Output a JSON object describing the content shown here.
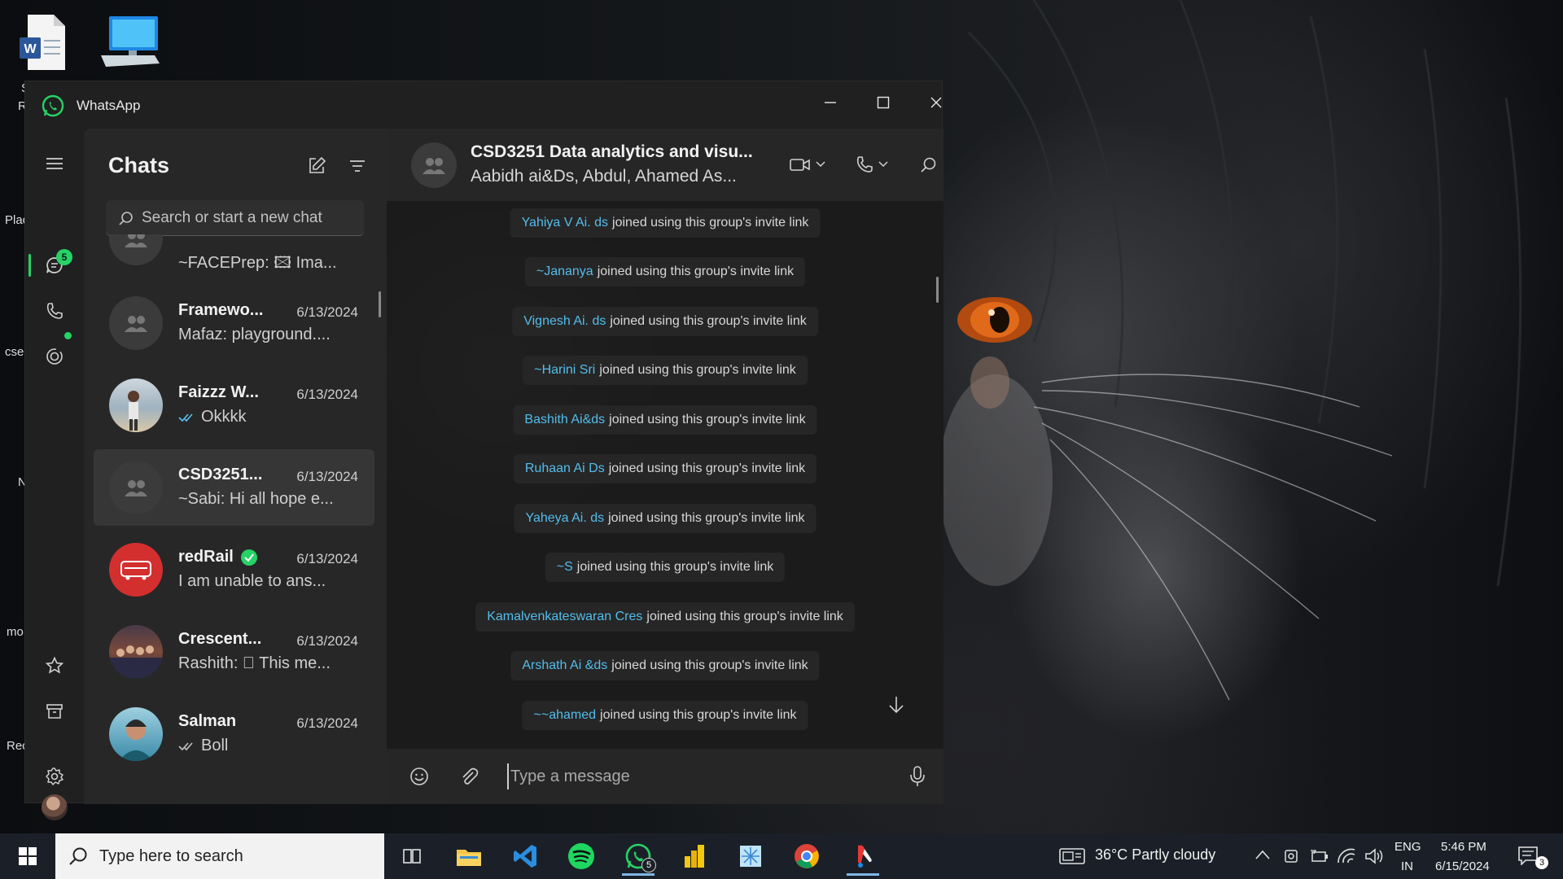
{
  "desktop": {
    "labels": [
      "S",
      "R",
      "Plac",
      "cse",
      "N",
      "mo",
      "Rec"
    ]
  },
  "window": {
    "title": "WhatsApp",
    "controls": {
      "minimize": "minimize-icon",
      "maximize": "maximize-icon",
      "close": "close-icon"
    }
  },
  "rail": {
    "chats_badge": "5",
    "items": [
      "menu-icon",
      "chats-icon",
      "calls-icon",
      "status-icon",
      "starred-icon",
      "archive-icon",
      "settings-icon",
      "profile-avatar"
    ]
  },
  "chatlist": {
    "title": "Chats",
    "search_placeholder": "Search or start a new chat",
    "items": [
      {
        "name": "",
        "date": "",
        "message": "~FACEPrep: 🖾 Ima...",
        "type": "group"
      },
      {
        "name": "Framewo...",
        "date": "6/13/2024",
        "message": "Mafaz: playground....",
        "type": "group"
      },
      {
        "name": "Faizzz W...",
        "date": "6/13/2024",
        "message": "Okkkk",
        "ticks": "read",
        "type": "person"
      },
      {
        "name": "CSD3251...",
        "date": "6/13/2024",
        "message": "~Sabi: Hi all hope e...",
        "type": "group",
        "active": true
      },
      {
        "name": "redRail",
        "date": "6/13/2024",
        "message": "I am unable to ans...",
        "type": "business",
        "verified": true
      },
      {
        "name": "Crescent...",
        "date": "6/13/2024",
        "message": "Rashith: ⃠ This me...",
        "type": "group"
      },
      {
        "name": "Salman",
        "date": "6/13/2024",
        "message": "Boll",
        "ticks": "read",
        "type": "person"
      }
    ]
  },
  "conversation": {
    "name": "CSD3251 Data analytics and visu...",
    "members": "Aabidh ai&Ds, Abdul, Ahamed As...",
    "system_suffix": "joined using this group's invite link",
    "system_messages": [
      "Yahiya V Ai. ds",
      "~Jananya",
      "Vignesh Ai. ds",
      "~Harini Sri",
      "Bashith Ai&ds",
      "Ruhaan Ai Ds",
      "Yaheya Ai. ds",
      "~S",
      "Kamalvenkateswaran Cres",
      "Arshath Ai &ds",
      "~~ahamed"
    ],
    "input_placeholder": "Type a message"
  },
  "taskbar": {
    "search_placeholder": "Type here to search",
    "whatsapp_badge": "5",
    "weather": "36°C  Partly cloudy",
    "language_top": "ENG",
    "language_bottom": "IN",
    "time": "5:46 PM",
    "date": "6/15/2024",
    "notification_count": "3"
  },
  "colors": {
    "accent": "#25d366",
    "link": "#53bdeb",
    "window_bg": "#202020",
    "taskbar_bg": "#1b2028"
  }
}
